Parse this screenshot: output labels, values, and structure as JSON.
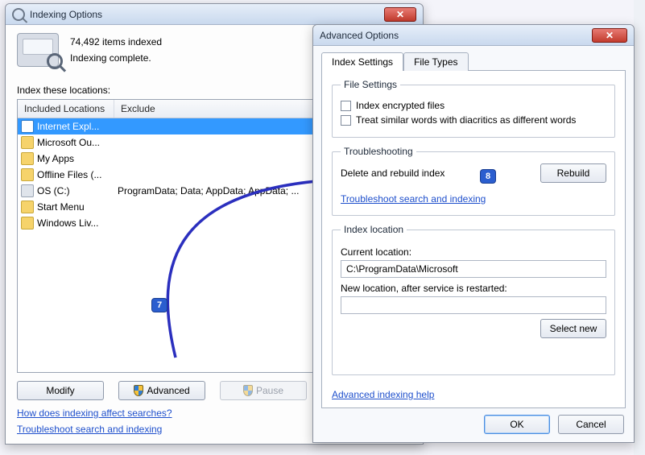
{
  "indexing": {
    "title": "Indexing Options",
    "items_indexed": "74,492 items indexed",
    "status": "Indexing complete.",
    "locations_label": "Index these locations:",
    "header_included": "Included Locations",
    "header_exclude": "Exclude",
    "rows": [
      {
        "name": "Internet Expl...",
        "exclude": "",
        "icon": "ie"
      },
      {
        "name": "Microsoft Ou...",
        "exclude": "",
        "icon": "folder"
      },
      {
        "name": "My Apps",
        "exclude": "",
        "icon": "folder"
      },
      {
        "name": "Offline Files (...",
        "exclude": "",
        "icon": "folder"
      },
      {
        "name": "OS (C:)",
        "exclude": "ProgramData; Data; AppData; AppData; ...",
        "icon": "disk"
      },
      {
        "name": "Start Menu",
        "exclude": "",
        "icon": "folder"
      },
      {
        "name": "Windows Liv...",
        "exclude": "",
        "icon": "folder"
      }
    ],
    "btn_modify": "Modify",
    "btn_advanced": "Advanced",
    "btn_pause": "Pause",
    "link_affect": "How does indexing affect searches?",
    "link_troubleshoot": "Troubleshoot search and indexing"
  },
  "advanced": {
    "title": "Advanced Options",
    "tab_settings": "Index Settings",
    "tab_filetypes": "File Types",
    "fs_legend": "File Settings",
    "chk_encrypted": "Index encrypted files",
    "chk_diacritics": "Treat similar words with diacritics as different words",
    "tb_legend": "Troubleshooting",
    "tb_delete": "Delete and rebuild index",
    "btn_rebuild": "Rebuild",
    "tb_link": "Troubleshoot search and indexing",
    "il_legend": "Index location",
    "il_current_label": "Current location:",
    "il_current_value": "C:\\ProgramData\\Microsoft",
    "il_new_label": "New location, after service is restarted:",
    "il_new_value": "",
    "btn_select_new": "Select new",
    "link_help": "Advanced indexing help",
    "btn_ok": "OK",
    "btn_cancel": "Cancel"
  },
  "annotations": {
    "badge7": "7",
    "badge8": "8"
  }
}
